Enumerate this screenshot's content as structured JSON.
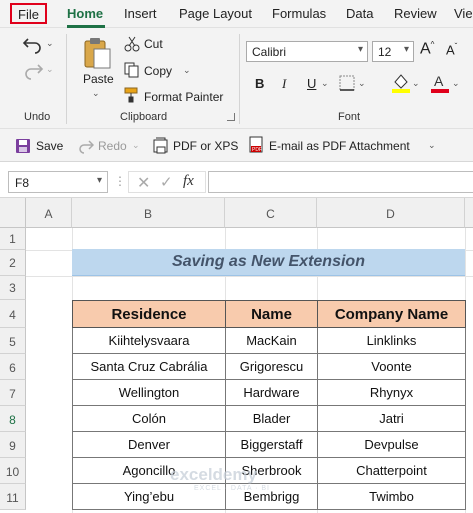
{
  "tabs": [
    "File",
    "Home",
    "Insert",
    "Page Layout",
    "Formulas",
    "Data",
    "Review",
    "Vie"
  ],
  "ribbon": {
    "undo_group": "Undo",
    "clipboard_group": "Clipboard",
    "font_group": "Font",
    "paste_label": "Paste",
    "cut_label": "Cut",
    "copy_label": "Copy",
    "format_painter_label": "Format Painter",
    "font_name": "Calibri",
    "font_size": "12",
    "bold": "B",
    "italic": "I",
    "underline": "U"
  },
  "qat": {
    "save": "Save",
    "redo": "Redo",
    "pdf": "PDF or XPS",
    "email_pdf": "E-mail as PDF Attachment"
  },
  "formula_bar": {
    "name_box": "F8",
    "fx": "fx",
    "content": ""
  },
  "columns": [
    "A",
    "B",
    "C",
    "D"
  ],
  "rows": [
    "1",
    "2",
    "3",
    "4",
    "5",
    "6",
    "7",
    "8",
    "9",
    "10",
    "11"
  ],
  "sheet": {
    "title": "Saving as New Extension",
    "headers": [
      "Residence",
      "Name",
      "Company Name"
    ],
    "data": [
      [
        "Kiihtelysvaara",
        "MacKain",
        "Linklinks"
      ],
      [
        "Santa Cruz Cabrália",
        "Grigorescu",
        "Voonte"
      ],
      [
        "Wellington",
        "Hardware",
        "Rhynyx"
      ],
      [
        "Colón",
        "Blader",
        "Jatri"
      ],
      [
        "Denver",
        "Biggerstaff",
        "Devpulse"
      ],
      [
        "Agoncillo",
        "Sherbrook",
        "Chatterpoint"
      ],
      [
        "Ying’ebu",
        "Bembrigg",
        "Twimbo"
      ]
    ]
  },
  "watermark": {
    "brand": "exceldemy",
    "tagline": "EXCEL · DATA · BI"
  },
  "colors": {
    "home_tab": "#1e7145",
    "file_highlight": "#e0001b",
    "title_fill": "#bdd7ee",
    "header_fill": "#f8cbad"
  }
}
